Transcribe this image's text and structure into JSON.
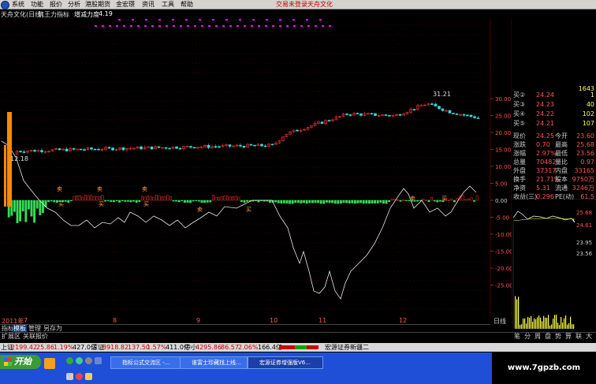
{
  "menu": {
    "items": [
      "系统",
      "功能",
      "报价",
      "分析",
      "港股期货",
      "金宏瓒",
      "资讯",
      "工具",
      "帮助"
    ],
    "login": "交易未登录",
    "brand": "天舟文化"
  },
  "title_row": {
    "stock": "天舟文化(日线)",
    "indicator": "筑王力指标",
    "metric_label": "增减力度",
    "metric_value": "4.19"
  },
  "chart_annotations": {
    "high": "31.21",
    "low": "12.18"
  },
  "price_axis": [
    "30.00",
    "25.00",
    "20.00",
    "15.00",
    "10.00",
    "5.00",
    "0.00",
    "-5.00",
    "-10.00",
    "-15.00",
    "-20.00",
    "-25.00"
  ],
  "date_axis": [
    "2011年",
    "7",
    "8",
    "9",
    "10",
    "11",
    "12"
  ],
  "signal_markers": [
    "卖",
    "买",
    "卖",
    "买",
    "卖",
    "买",
    "卖",
    "买",
    "卖",
    "买"
  ],
  "order_book": [
    {
      "label": "买②",
      "price": "24.24",
      "vol": "1"
    },
    {
      "label": "买③",
      "price": "24.23",
      "vol": "40"
    },
    {
      "label": "买④",
      "price": "24.22",
      "vol": "102"
    },
    {
      "label": "买⑤",
      "price": "24.21",
      "vol": "107"
    }
  ],
  "order_book_top_vol": "1643",
  "stats": [
    {
      "l1": "现价",
      "v1": "24.25",
      "l2": "今开",
      "v2": "23.60"
    },
    {
      "l1": "涨跌",
      "v1": "0.70",
      "l2": "最高",
      "v2": "25.68"
    },
    {
      "l1": "涨幅",
      "v1": "2.97%",
      "l2": "最低",
      "v2": "23.56"
    },
    {
      "l1": "总量",
      "v1": "70482",
      "l2": "量比",
      "v2": "0.97"
    },
    {
      "l1": "外盘",
      "v1": "37317",
      "l2": "内盘",
      "v2": "33165"
    },
    {
      "l1": "换手",
      "v1": "21.71%",
      "l2": "股本",
      "v2": "9750万"
    },
    {
      "l1": "净资",
      "v1": "5.31",
      "l2": "流通",
      "v2": "3246万"
    },
    {
      "l1": "收益(三)",
      "v1": "0.296",
      "l2": "PE(动)",
      "v2": "61.5"
    }
  ],
  "mini_chart": {
    "axis": [
      "25.68",
      "24.61",
      "23.95",
      "23.56"
    ]
  },
  "tabs": [
    "指标",
    "模板",
    "管理",
    "另存为"
  ],
  "ext_tabs": [
    "扩展区",
    "关联报价"
  ],
  "right_tab": "日线",
  "tool_icons": [
    "笔",
    "分",
    "周",
    "盘",
    "势",
    "算",
    "联",
    "大"
  ],
  "status": {
    "sh_label": "上证",
    "sh_value": "2199.42",
    "sh_change": "25.86",
    "sh_pct": "1.19%",
    "sh_amount": "427.0亿",
    "sz_label": "深证",
    "sz_value": "8918.82",
    "sz_change": "137.50",
    "sz_pct": "1.57%",
    "sz_amount": "411.0亿",
    "zx_label": "中小",
    "zx_value": "4295.86",
    "zx_change": "86.57",
    "zx_pct": "2.06%",
    "zx_amount": "166.4亿",
    "broker": "宏源证券新疆二"
  },
  "taskbar": {
    "start": "开始",
    "tasks": [
      "指标公式交流区 -...",
      "谁富士珍藏找上线...",
      "宏源证券增强版V6..."
    ]
  },
  "watermark": "www.7gpzb.com",
  "colors": {
    "up": "#ff3333",
    "down": "#33dddd",
    "white_line": "#e8e8e8",
    "magenta": "#ff00ff",
    "volume_bar": "#ff8800"
  }
}
